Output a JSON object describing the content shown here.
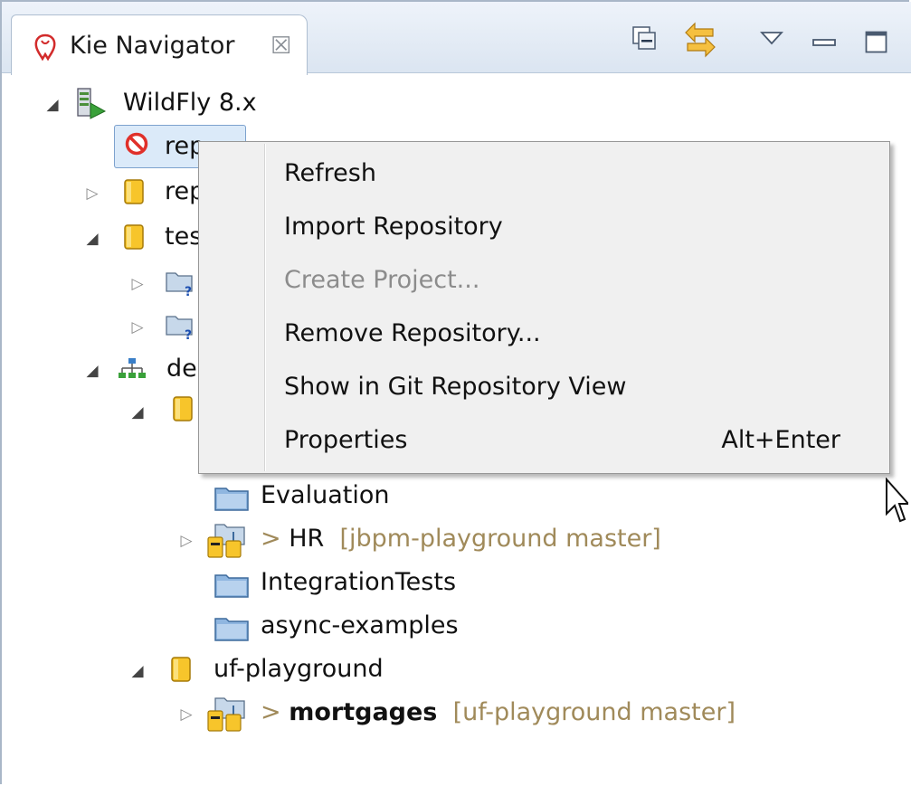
{
  "view": {
    "title": "Kie Navigator",
    "close_glyph": "☒"
  },
  "toolbar": {
    "icons": [
      "collapse-all-icon",
      "link-with-editor-icon",
      "view-menu-icon",
      "minimize-icon",
      "maximize-icon"
    ]
  },
  "tree": {
    "server": {
      "label": "WildFly 8.x"
    },
    "repo_selected": {
      "label": "rep"
    },
    "repo_2": {
      "label": "rep"
    },
    "repo_test": {
      "label": "tes"
    },
    "de_node": {
      "label": "de"
    },
    "projects": {
      "evaluation": "Evaluation",
      "hr_prefix": "> ",
      "hr_name": "HR",
      "hr_decoration": "[jbpm-playground master]",
      "integration_tests": "IntegrationTests",
      "async_examples": "async-examples"
    },
    "uf_playground": {
      "label": "uf-playground"
    },
    "mortgages": {
      "prefix": "> ",
      "name": "mortgages",
      "decoration": "[uf-playground master]"
    }
  },
  "context_menu": {
    "items": [
      {
        "label": "Refresh",
        "shortcut": "",
        "enabled": true
      },
      {
        "label": "Import Repository",
        "shortcut": "",
        "enabled": true
      },
      {
        "label": "Create Project...",
        "shortcut": "",
        "enabled": false
      },
      {
        "label": "Remove Repository...",
        "shortcut": "",
        "enabled": true
      },
      {
        "label": "Show in Git Repository View",
        "shortcut": "",
        "enabled": true
      },
      {
        "label": "Properties",
        "shortcut": "Alt+Enter",
        "enabled": true
      }
    ]
  },
  "colors": {
    "header_bg": "#dbe5f1",
    "menu_bg": "#f0f0f0",
    "selection_bg": "#dbeaf9",
    "decoration_text": "#a08a5a",
    "disabled_text": "#8c8c8c"
  }
}
